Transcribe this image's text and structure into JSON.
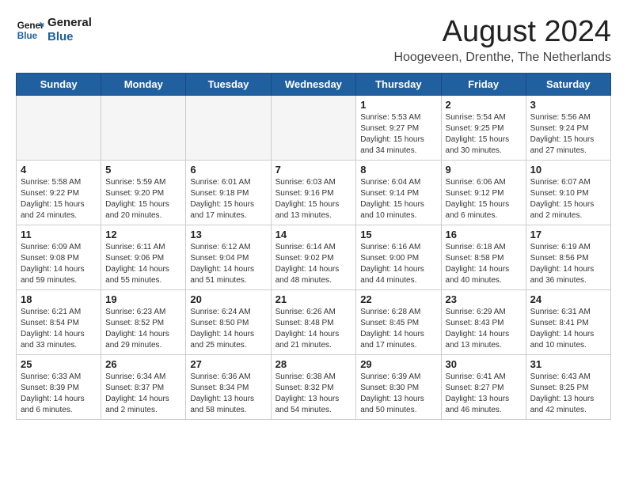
{
  "header": {
    "logo_general": "General",
    "logo_blue": "Blue",
    "month_year": "August 2024",
    "location": "Hoogeveen, Drenthe, The Netherlands"
  },
  "weekdays": [
    "Sunday",
    "Monday",
    "Tuesday",
    "Wednesday",
    "Thursday",
    "Friday",
    "Saturday"
  ],
  "weeks": [
    [
      {
        "day": "",
        "empty": true
      },
      {
        "day": "",
        "empty": true
      },
      {
        "day": "",
        "empty": true
      },
      {
        "day": "",
        "empty": true
      },
      {
        "day": "1",
        "sunrise": "5:53 AM",
        "sunset": "9:27 PM",
        "daylight": "15 hours and 34 minutes."
      },
      {
        "day": "2",
        "sunrise": "5:54 AM",
        "sunset": "9:25 PM",
        "daylight": "15 hours and 30 minutes."
      },
      {
        "day": "3",
        "sunrise": "5:56 AM",
        "sunset": "9:24 PM",
        "daylight": "15 hours and 27 minutes."
      }
    ],
    [
      {
        "day": "4",
        "sunrise": "5:58 AM",
        "sunset": "9:22 PM",
        "daylight": "15 hours and 24 minutes."
      },
      {
        "day": "5",
        "sunrise": "5:59 AM",
        "sunset": "9:20 PM",
        "daylight": "15 hours and 20 minutes."
      },
      {
        "day": "6",
        "sunrise": "6:01 AM",
        "sunset": "9:18 PM",
        "daylight": "15 hours and 17 minutes."
      },
      {
        "day": "7",
        "sunrise": "6:03 AM",
        "sunset": "9:16 PM",
        "daylight": "15 hours and 13 minutes."
      },
      {
        "day": "8",
        "sunrise": "6:04 AM",
        "sunset": "9:14 PM",
        "daylight": "15 hours and 10 minutes."
      },
      {
        "day": "9",
        "sunrise": "6:06 AM",
        "sunset": "9:12 PM",
        "daylight": "15 hours and 6 minutes."
      },
      {
        "day": "10",
        "sunrise": "6:07 AM",
        "sunset": "9:10 PM",
        "daylight": "15 hours and 2 minutes."
      }
    ],
    [
      {
        "day": "11",
        "sunrise": "6:09 AM",
        "sunset": "9:08 PM",
        "daylight": "14 hours and 59 minutes."
      },
      {
        "day": "12",
        "sunrise": "6:11 AM",
        "sunset": "9:06 PM",
        "daylight": "14 hours and 55 minutes."
      },
      {
        "day": "13",
        "sunrise": "6:12 AM",
        "sunset": "9:04 PM",
        "daylight": "14 hours and 51 minutes."
      },
      {
        "day": "14",
        "sunrise": "6:14 AM",
        "sunset": "9:02 PM",
        "daylight": "14 hours and 48 minutes."
      },
      {
        "day": "15",
        "sunrise": "6:16 AM",
        "sunset": "9:00 PM",
        "daylight": "14 hours and 44 minutes."
      },
      {
        "day": "16",
        "sunrise": "6:18 AM",
        "sunset": "8:58 PM",
        "daylight": "14 hours and 40 minutes."
      },
      {
        "day": "17",
        "sunrise": "6:19 AM",
        "sunset": "8:56 PM",
        "daylight": "14 hours and 36 minutes."
      }
    ],
    [
      {
        "day": "18",
        "sunrise": "6:21 AM",
        "sunset": "8:54 PM",
        "daylight": "14 hours and 33 minutes."
      },
      {
        "day": "19",
        "sunrise": "6:23 AM",
        "sunset": "8:52 PM",
        "daylight": "14 hours and 29 minutes."
      },
      {
        "day": "20",
        "sunrise": "6:24 AM",
        "sunset": "8:50 PM",
        "daylight": "14 hours and 25 minutes."
      },
      {
        "day": "21",
        "sunrise": "6:26 AM",
        "sunset": "8:48 PM",
        "daylight": "14 hours and 21 minutes."
      },
      {
        "day": "22",
        "sunrise": "6:28 AM",
        "sunset": "8:45 PM",
        "daylight": "14 hours and 17 minutes."
      },
      {
        "day": "23",
        "sunrise": "6:29 AM",
        "sunset": "8:43 PM",
        "daylight": "14 hours and 13 minutes."
      },
      {
        "day": "24",
        "sunrise": "6:31 AM",
        "sunset": "8:41 PM",
        "daylight": "14 hours and 10 minutes."
      }
    ],
    [
      {
        "day": "25",
        "sunrise": "6:33 AM",
        "sunset": "8:39 PM",
        "daylight": "14 hours and 6 minutes."
      },
      {
        "day": "26",
        "sunrise": "6:34 AM",
        "sunset": "8:37 PM",
        "daylight": "14 hours and 2 minutes."
      },
      {
        "day": "27",
        "sunrise": "6:36 AM",
        "sunset": "8:34 PM",
        "daylight": "13 hours and 58 minutes."
      },
      {
        "day": "28",
        "sunrise": "6:38 AM",
        "sunset": "8:32 PM",
        "daylight": "13 hours and 54 minutes."
      },
      {
        "day": "29",
        "sunrise": "6:39 AM",
        "sunset": "8:30 PM",
        "daylight": "13 hours and 50 minutes."
      },
      {
        "day": "30",
        "sunrise": "6:41 AM",
        "sunset": "8:27 PM",
        "daylight": "13 hours and 46 minutes."
      },
      {
        "day": "31",
        "sunrise": "6:43 AM",
        "sunset": "8:25 PM",
        "daylight": "13 hours and 42 minutes."
      }
    ]
  ]
}
